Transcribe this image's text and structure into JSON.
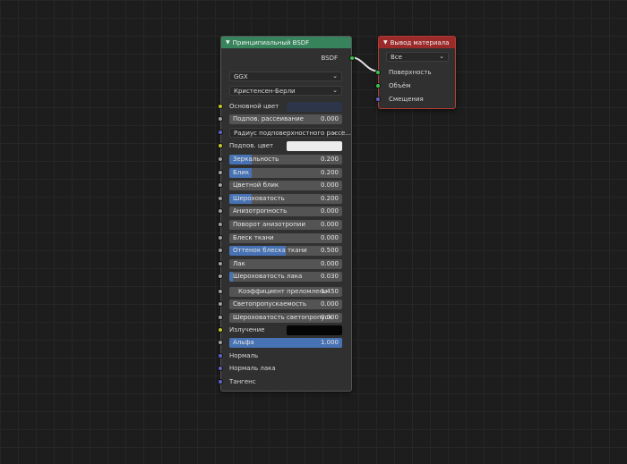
{
  "bsdf": {
    "title": "Принципиальный BSDF",
    "output_label": "BSDF",
    "distribution": "GGX",
    "subsurface_method": "Кристенсен-Берли",
    "base_color": {
      "label": "Основной цвет",
      "color": "#2c3549"
    },
    "subsurface": {
      "label": "Подпов. рассеивание",
      "value": "0.000"
    },
    "subsurface_radius": {
      "label": "Радиус подповерхностного рассе..."
    },
    "subsurface_color": {
      "label": "Подпов. цвет",
      "color": "#ececec"
    },
    "sliders": [
      {
        "label": "Зеркальность",
        "value": "0.200",
        "fill": 0.2
      },
      {
        "label": "Блик",
        "value": "0.200",
        "fill": 0.2
      },
      {
        "label": "Цветной блик",
        "value": "0.000",
        "fill": 0
      },
      {
        "label": "Шероховатость",
        "value": "0.200",
        "fill": 0.2
      },
      {
        "label": "Анизотропность",
        "value": "0.000",
        "fill": 0
      },
      {
        "label": "Поворот анизотропии",
        "value": "0.000",
        "fill": 0
      },
      {
        "label": "Блеск ткани",
        "value": "0.000",
        "fill": 0
      },
      {
        "label": "Оттенок блеска ткани",
        "value": "0.500",
        "fill": 0.5
      },
      {
        "label": "Лак",
        "value": "0.000",
        "fill": 0
      },
      {
        "label": "Шероховатость лака",
        "value": "0.030",
        "fill": 0.03
      }
    ],
    "ior": {
      "label": "Коэффициент преломлени",
      "value": "1.450"
    },
    "transmission": {
      "label": "Светопропускаемость",
      "value": "0.000"
    },
    "transmission_roughness": {
      "label": "Шероховатость светопропуск",
      "value": "0.000"
    },
    "emission": {
      "label": "Излучение",
      "color": "#050505"
    },
    "alpha": {
      "label": "Альфа",
      "value": "1.000",
      "fill": 1.0
    },
    "normal": "Нормаль",
    "clearcoat_normal": "Нормаль лака",
    "tangent": "Тангенс"
  },
  "output_node": {
    "title": "Вывод материала",
    "target": "Все",
    "inputs": [
      "Поверхность",
      "Объём",
      "Смещения"
    ]
  },
  "colors": {
    "bsdf_header": "#37845c",
    "output_header": "#9b2a2a",
    "slider_fill": "#4772b3",
    "socket_shader": "#3ec34d",
    "socket_color": "#c7c729",
    "socket_float": "#a1a1a1",
    "socket_vector": "#6363c7"
  }
}
